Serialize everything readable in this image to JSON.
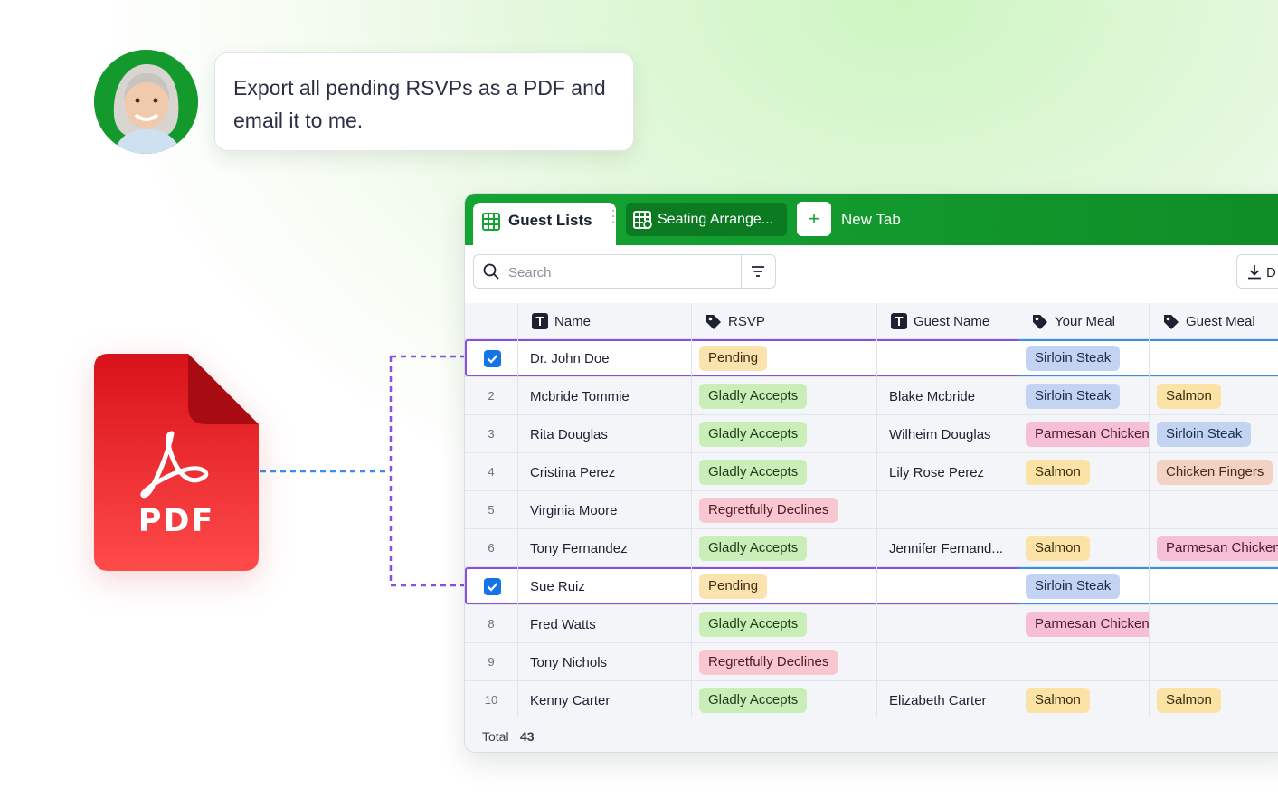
{
  "chat": {
    "message": "Export all pending RSVPs as a PDF and email it to me."
  },
  "file": {
    "type_label": "PDF"
  },
  "tabs": {
    "active": "Guest Lists",
    "second": "Seating Arrange...",
    "new_tab": "New Tab"
  },
  "toolbar": {
    "search_placeholder": "Search",
    "download_label": "D"
  },
  "columns": {
    "name": "Name",
    "rsvp": "RSVP",
    "guest_name": "Guest Name",
    "your_meal": "Your Meal",
    "guest_meal": "Guest Meal"
  },
  "rows": [
    {
      "num": "",
      "checked": true,
      "name": "Dr. John Doe",
      "rsvp": "Pending",
      "guest_name": "",
      "your_meal": "Sirloin Steak",
      "guest_meal": ""
    },
    {
      "num": "2",
      "checked": false,
      "name": "Mcbride Tommie",
      "rsvp": "Gladly Accepts",
      "guest_name": "Blake Mcbride",
      "your_meal": "Sirloin Steak",
      "guest_meal": "Salmon"
    },
    {
      "num": "3",
      "checked": false,
      "name": "Rita Douglas",
      "rsvp": "Gladly Accepts",
      "guest_name": "Wilheim Douglas",
      "your_meal": "Parmesan Chicken",
      "guest_meal": "Sirloin Steak"
    },
    {
      "num": "4",
      "checked": false,
      "name": "Cristina Perez",
      "rsvp": "Gladly Accepts",
      "guest_name": "Lily Rose Perez",
      "your_meal": "Salmon",
      "guest_meal": "Chicken Fingers"
    },
    {
      "num": "5",
      "checked": false,
      "name": "Virginia Moore",
      "rsvp": "Regretfully Declines",
      "guest_name": "",
      "your_meal": "",
      "guest_meal": ""
    },
    {
      "num": "6",
      "checked": false,
      "name": "Tony Fernandez",
      "rsvp": "Gladly Accepts",
      "guest_name": "Jennifer Fernand...",
      "your_meal": "Salmon",
      "guest_meal": "Parmesan Chicken"
    },
    {
      "num": "",
      "checked": true,
      "name": "Sue Ruiz",
      "rsvp": "Pending",
      "guest_name": "",
      "your_meal": "Sirloin Steak",
      "guest_meal": ""
    },
    {
      "num": "8",
      "checked": false,
      "name": "Fred Watts",
      "rsvp": "Gladly Accepts",
      "guest_name": "",
      "your_meal": "Parmesan Chicken",
      "guest_meal": ""
    },
    {
      "num": "9",
      "checked": false,
      "name": "Tony Nichols",
      "rsvp": "Regretfully Declines",
      "guest_name": "",
      "your_meal": "",
      "guest_meal": ""
    },
    {
      "num": "10",
      "checked": false,
      "name": "Kenny Carter",
      "rsvp": "Gladly Accepts",
      "guest_name": "Elizabeth Carter",
      "your_meal": "Salmon",
      "guest_meal": "Salmon"
    }
  ],
  "footer": {
    "total_label": "Total",
    "total_value": "43"
  },
  "colors": {
    "brand_green": "#14a432",
    "selection_purple": "#8a4fe0",
    "selection_blue": "#3b8ee6",
    "pdf_red": "#e8262b"
  }
}
